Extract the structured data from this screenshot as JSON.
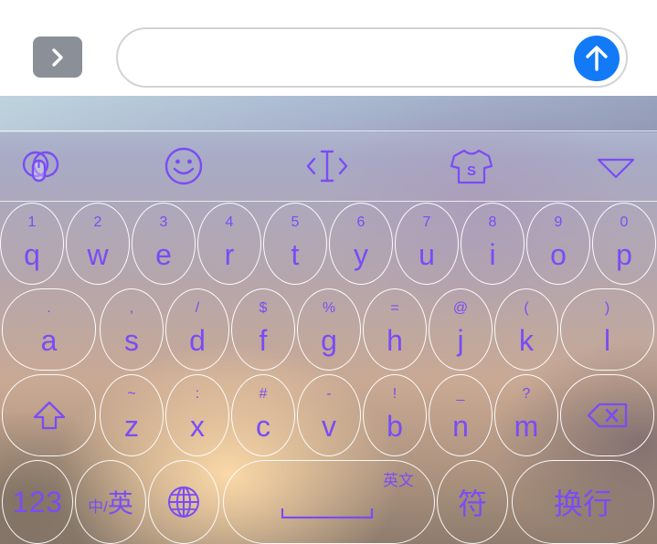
{
  "top": {
    "expand_icon": "chevron-right-icon",
    "input_value": "",
    "input_placeholder": "",
    "send_icon": "arrow-up-icon",
    "send_color": "#127af7"
  },
  "toolbar": {
    "items": [
      "app-switch-icon",
      "emoji-icon",
      "cursor-icon",
      "skin-icon",
      "collapse-icon"
    ]
  },
  "keyboard": {
    "accent_color": "#7a4cf5",
    "row1": [
      {
        "hint": "1",
        "key": "q"
      },
      {
        "hint": "2",
        "key": "w"
      },
      {
        "hint": "3",
        "key": "e"
      },
      {
        "hint": "4",
        "key": "r"
      },
      {
        "hint": "5",
        "key": "t"
      },
      {
        "hint": "6",
        "key": "y"
      },
      {
        "hint": "7",
        "key": "u"
      },
      {
        "hint": "8",
        "key": "i"
      },
      {
        "hint": "9",
        "key": "o"
      },
      {
        "hint": "0",
        "key": "p"
      }
    ],
    "row2": [
      {
        "hint": ".",
        "key": "a"
      },
      {
        "hint": ",",
        "key": "s"
      },
      {
        "hint": "/",
        "key": "d"
      },
      {
        "hint": "$",
        "key": "f"
      },
      {
        "hint": "%",
        "key": "g"
      },
      {
        "hint": "=",
        "key": "h"
      },
      {
        "hint": "@",
        "key": "j"
      },
      {
        "hint": "(",
        "key": "k"
      },
      {
        "hint": ")",
        "key": "l"
      }
    ],
    "row3": [
      {
        "hint": "~",
        "key": "z"
      },
      {
        "hint": ":",
        "key": "x"
      },
      {
        "hint": "#",
        "key": "c"
      },
      {
        "hint": "-",
        "key": "v"
      },
      {
        "hint": "!",
        "key": "b"
      },
      {
        "hint": "_",
        "key": "n"
      },
      {
        "hint": "?",
        "key": "m"
      }
    ],
    "shift_icon": "shift-icon",
    "delete_icon": "delete-icon",
    "numbers_label": "123",
    "lang_small": "中/",
    "lang_big": "英",
    "globe_icon": "globe-icon",
    "space_label": "英文",
    "symbols_label": "符",
    "return_label": "换行"
  }
}
